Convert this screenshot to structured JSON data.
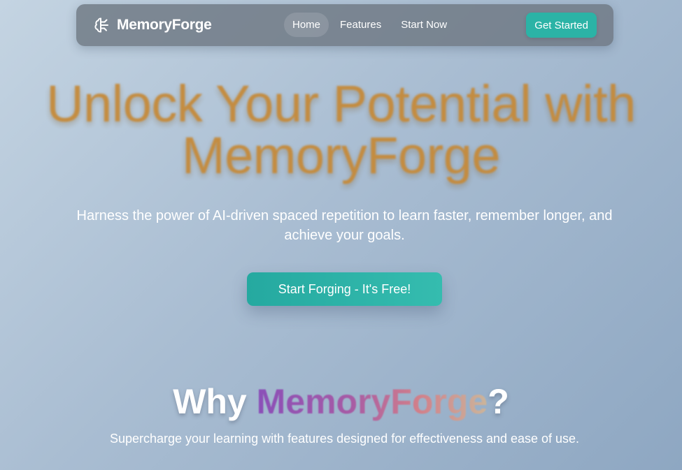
{
  "navbar": {
    "brand_name": "MemoryForge",
    "brand_icon": "brain-icon",
    "links": [
      {
        "label": "Home",
        "active": true
      },
      {
        "label": "Features",
        "active": false
      },
      {
        "label": "Start Now",
        "active": false
      }
    ],
    "cta_label": "Get Started"
  },
  "hero": {
    "title": "Unlock Your Potential with MemoryForge",
    "subtitle": "Harness the power of AI-driven spaced repetition to learn faster, remember longer, and achieve your goals.",
    "cta_label": "Start Forging - It's Free!"
  },
  "why": {
    "title_prefix": "Why ",
    "title_brand": "MemoryForge",
    "title_suffix": "?",
    "subtitle": "Supercharge your learning with features designed for effectiveness and ease of use."
  },
  "colors": {
    "accent": "#2bb3a6",
    "hero_title": "#c58a3a",
    "navbar_bg": "#6e7882"
  }
}
